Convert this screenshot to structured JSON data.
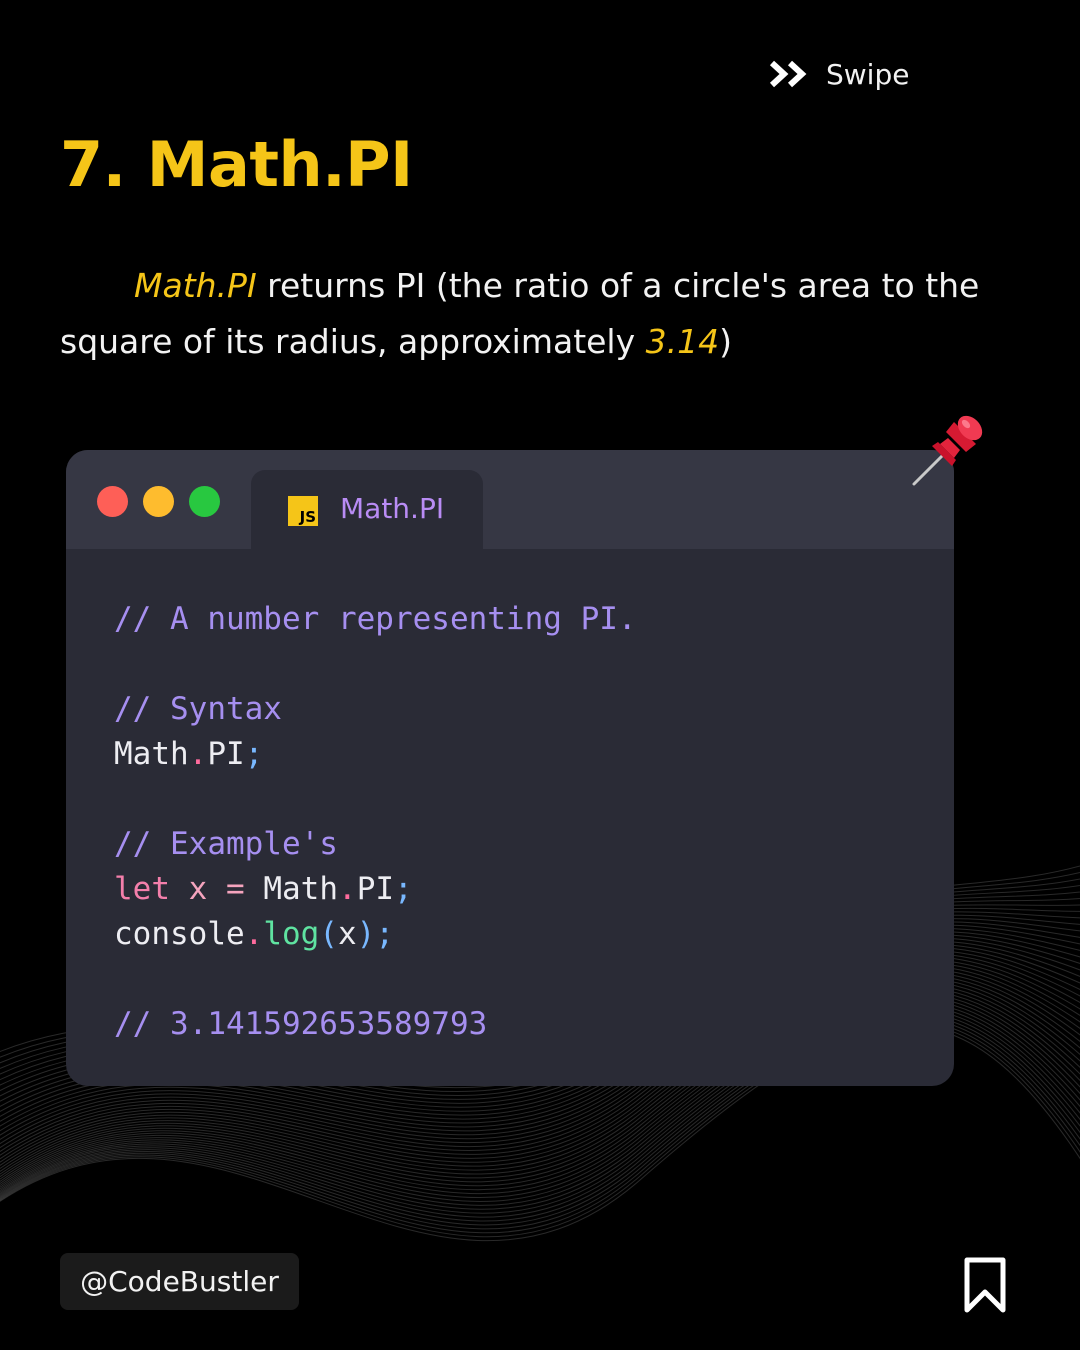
{
  "header": {
    "swipe_label": "Swipe",
    "swipe_icon": "double-chevron-right-icon"
  },
  "slide": {
    "title": "7. Math.PI",
    "description": {
      "highlight": "Math.PI",
      "text_main": " returns PI (the ratio of a circle's area to the square of its radius, approximately ",
      "value": "3.14",
      "closing": ")"
    }
  },
  "editor": {
    "window_controls": [
      "close",
      "minimize",
      "maximize"
    ],
    "tab": {
      "icon_label": "JS",
      "label": "Math.PI"
    },
    "code": {
      "comment1": "// A number representing PI.",
      "comment2": "// Syntax",
      "syntax_obj": "Math",
      "syntax_prop": "PI",
      "comment3": "// Example's",
      "kw_let": "let",
      "var_x": "x",
      "op_eq": "=",
      "ex_obj": "Math",
      "ex_prop": "PI",
      "console_obj": "console",
      "console_fn": "log",
      "console_arg": "x",
      "result_comment": "// 3.141592653589793"
    }
  },
  "footer": {
    "handle": "@CodeBustler",
    "bookmark_icon": "bookmark-icon"
  },
  "colors": {
    "accent": "#f5c518",
    "background": "#000000",
    "editor_bg": "#2a2b36",
    "titlebar_bg": "#363744",
    "comment": "#a68ff0"
  }
}
